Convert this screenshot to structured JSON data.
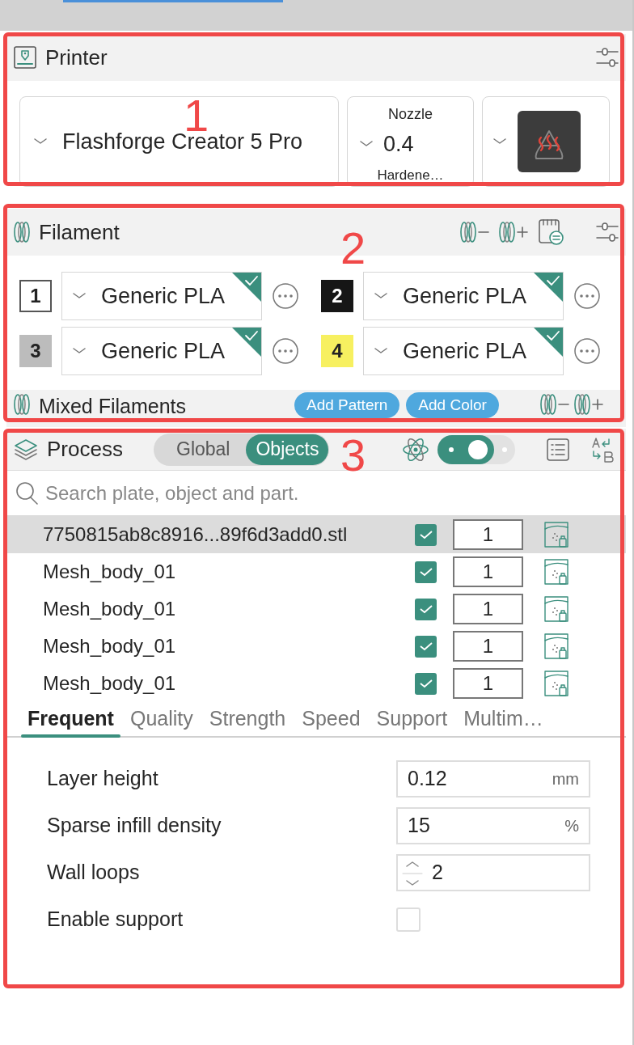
{
  "annotations": [
    {
      "label": "1"
    },
    {
      "label": "2"
    },
    {
      "label": "3"
    }
  ],
  "printer": {
    "title": "Printer",
    "model": "Flashforge Creator 5 Pro",
    "nozzle": {
      "label": "Nozzle",
      "size": "0.4",
      "type": "Hardene…"
    }
  },
  "filament": {
    "title": "Filament",
    "slots": [
      {
        "number": "1",
        "color": "#ffffff",
        "name": "Generic PLA"
      },
      {
        "number": "2",
        "color": "#161616",
        "name": "Generic PLA"
      },
      {
        "number": "3",
        "color": "#bcbcbc",
        "name": "Generic PLA"
      },
      {
        "number": "4",
        "color": "#f7f060",
        "name": "Generic PLA"
      }
    ]
  },
  "mixed_filaments": {
    "title": "Mixed Filaments",
    "buttons": [
      "Add Pattern",
      "Add Color"
    ]
  },
  "process": {
    "title": "Process",
    "modes": [
      {
        "label": "Global",
        "selected": false
      },
      {
        "label": "Objects",
        "selected": true
      }
    ],
    "advanced_toggle": {
      "on": true
    },
    "search": {
      "placeholder": "Search plate, object and part."
    },
    "objects": [
      {
        "name": "7750815ab8c8916...89f6d3add0.stl",
        "selected": true,
        "checked": true,
        "count": "1"
      },
      {
        "name": "Mesh_body_01",
        "selected": false,
        "checked": true,
        "count": "1"
      },
      {
        "name": "Mesh_body_01",
        "selected": false,
        "checked": true,
        "count": "1"
      },
      {
        "name": "Mesh_body_01",
        "selected": false,
        "checked": true,
        "count": "1"
      },
      {
        "name": "Mesh_body_01",
        "selected": false,
        "checked": true,
        "count": "1"
      }
    ],
    "tabs": [
      {
        "label": "Frequent",
        "selected": true
      },
      {
        "label": "Quality",
        "selected": false
      },
      {
        "label": "Strength",
        "selected": false
      },
      {
        "label": "Speed",
        "selected": false
      },
      {
        "label": "Support",
        "selected": false
      },
      {
        "label": "Multim…",
        "selected": false
      }
    ],
    "settings": [
      {
        "kind": "number",
        "label": "Layer height",
        "value": "0.12",
        "unit": "mm"
      },
      {
        "kind": "number",
        "label": "Sparse infill density",
        "value": "15",
        "unit": "%"
      },
      {
        "kind": "spin",
        "label": "Wall loops",
        "value": "2"
      },
      {
        "kind": "checkbox",
        "label": "Enable support",
        "checked": false
      }
    ]
  }
}
